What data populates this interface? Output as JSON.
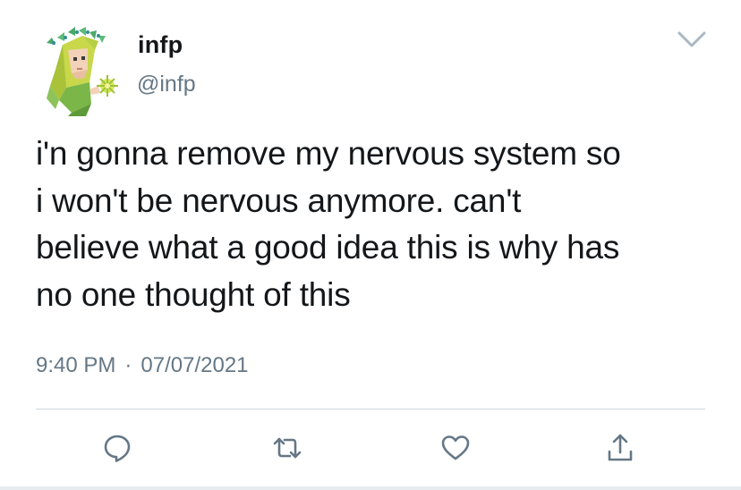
{
  "user": {
    "display_name": "infp",
    "handle": "@infp"
  },
  "tweet": {
    "text": "i'n gonna remove my nervous system so\ni won't be nervous anymore. can't\nbelieve what a good idea this is why has\nno one thought of this",
    "time": "9:40 PM",
    "separator": "·",
    "date": "07/07/2021"
  },
  "icons": {
    "avatar": "avatar-image",
    "menu": "chevron-down-icon",
    "reply": "reply-icon",
    "retweet": "retweet-icon",
    "like": "heart-icon",
    "share": "share-icon"
  },
  "colors": {
    "text": "#14171a",
    "secondary": "#657786",
    "icon": "#657786",
    "divider": "#ccd6dd",
    "chevron": "#aab8c2"
  }
}
